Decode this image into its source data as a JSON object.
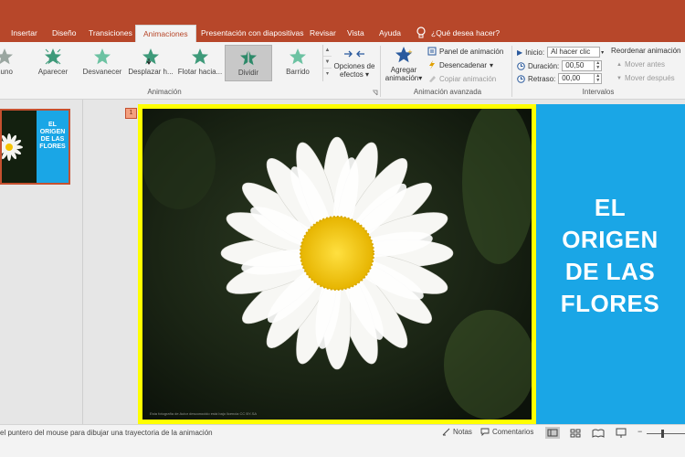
{
  "tabs": [
    {
      "label": "Insertar",
      "active": false
    },
    {
      "label": "Diseño",
      "active": false
    },
    {
      "label": "Transiciones",
      "active": false
    },
    {
      "label": "Animaciones",
      "active": true
    },
    {
      "label": "Presentación con diapositivas",
      "active": false
    },
    {
      "label": "Revisar",
      "active": false
    },
    {
      "label": "Vista",
      "active": false
    },
    {
      "label": "Ayuda",
      "active": false
    }
  ],
  "tell_me": "¿Qué desea hacer?",
  "animation_gallery": [
    {
      "label": "guno",
      "icon": "star-none-icon"
    },
    {
      "label": "Aparecer",
      "icon": "star-appear-icon"
    },
    {
      "label": "Desvanecer",
      "icon": "star-fade-icon"
    },
    {
      "label": "Desplazar h...",
      "icon": "star-fly-in-icon"
    },
    {
      "label": "Flotar hacia...",
      "icon": "star-float-in-icon"
    },
    {
      "label": "Dividir",
      "icon": "star-split-icon",
      "selected": true
    },
    {
      "label": "Barrido",
      "icon": "star-wipe-icon"
    }
  ],
  "effect_options": {
    "line1": "Opciones de",
    "line2": "efectos"
  },
  "group_labels": {
    "animation": "Animación",
    "advanced": "Animación avanzada",
    "timing": "Intervalos"
  },
  "advanced": {
    "add_line1": "Agregar",
    "add_line2": "animación",
    "panel": "Panel de animación",
    "trigger": "Desencadenar",
    "copy": "Copiar animación"
  },
  "timing": {
    "start_label": "Inicio:",
    "start_value": "Al hacer clic",
    "duration_label": "Duración:",
    "duration_value": "00,50",
    "delay_label": "Retraso:",
    "delay_value": "00,00",
    "reorder_title": "Reordenar animación",
    "move_earlier": "Mover antes",
    "move_later": "Mover después"
  },
  "slide_panel": {
    "slide_number": "1",
    "thumb_title": "EL ORIGEN DE LAS FLORES"
  },
  "slide": {
    "title_lines": [
      "EL",
      "ORIGEN",
      "DE LAS",
      "FLORES"
    ],
    "caption": "Esta fotografía de Autor desconocido está bajo licencia CC BY-SA"
  },
  "status": {
    "hint": "el puntero del mouse para dibujar una trayectoria de la animación",
    "notes": "Notas",
    "comments": "Comentarios"
  },
  "colors": {
    "accent": "#b7472a",
    "slide_panel_blue": "#1aa6e6",
    "photo_border": "#ffff00",
    "title_text": "#ffffff"
  }
}
